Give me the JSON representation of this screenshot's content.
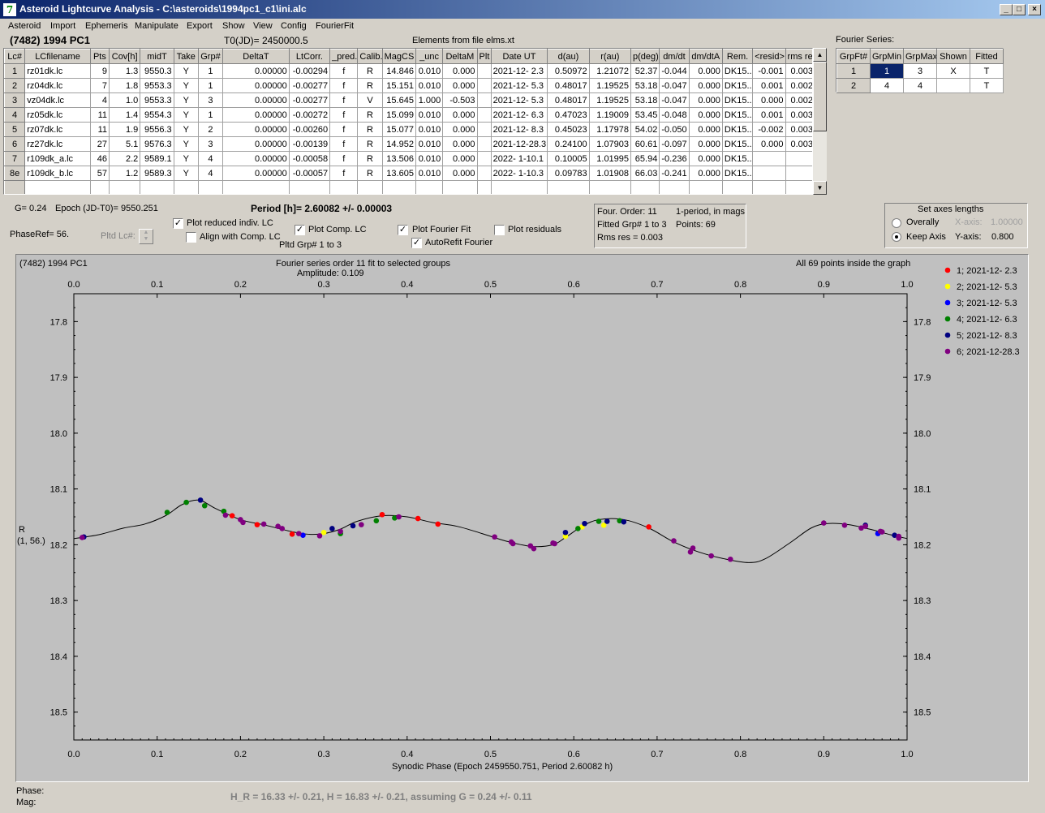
{
  "window": {
    "title": "Asteroid Lightcurve Analysis - C:\\asteroids\\1994pc1_c1\\ini.alc",
    "minimize": "_",
    "maximize": "□",
    "close": "×"
  },
  "menu": [
    "Asteroid",
    "Import",
    "Ephemeris",
    "Manipulate",
    "Export",
    "Show",
    "View",
    "Config",
    "FourierFit"
  ],
  "header": {
    "asteroid": "(7482) 1994 PC1",
    "t0": "T0(JD)= 2450000.5",
    "elements": "Elements from file elms.xt"
  },
  "lc_table": {
    "columns": [
      "Lc#",
      "LCfilename",
      "Pts",
      "Cov[h]",
      "midT",
      "Take",
      "Grp#",
      "DeltaT",
      "LtCorr.",
      "_pred.",
      "Calib.",
      "MagCS",
      "_unc",
      "DeltaM",
      "Plt",
      "Date UT",
      "d(au)",
      "r(au)",
      "p(deg)",
      "dm/dt",
      "dm/dtA",
      "Rem.",
      "<resid>",
      "rms res"
    ],
    "rows": [
      [
        "1",
        "rz01dk.lc",
        "9",
        "1.3",
        "9550.3",
        "Y",
        "1",
        "0.00000",
        "-0.00294",
        "f",
        "R",
        "14.846",
        "0.010",
        "0.000",
        "",
        "2021-12- 2.3",
        "0.50972",
        "1.21072",
        "52.37",
        "-0.044",
        "0.000",
        "DK15..",
        "-0.001",
        "0.003"
      ],
      [
        "2",
        "rz04dk.lc",
        "7",
        "1.8",
        "9553.3",
        "Y",
        "1",
        "0.00000",
        "-0.00277",
        "f",
        "R",
        "15.151",
        "0.010",
        "0.000",
        "",
        "2021-12- 5.3",
        "0.48017",
        "1.19525",
        "53.18",
        "-0.047",
        "0.000",
        "DK15..",
        "0.001",
        "0.002"
      ],
      [
        "3",
        "vz04dk.lc",
        "4",
        "1.0",
        "9553.3",
        "Y",
        "3",
        "0.00000",
        "-0.00277",
        "f",
        "V",
        "15.645",
        "1.000",
        "-0.503",
        "",
        "2021-12- 5.3",
        "0.48017",
        "1.19525",
        "53.18",
        "-0.047",
        "0.000",
        "DK15..",
        "0.000",
        "0.002"
      ],
      [
        "4",
        "rz05dk.lc",
        "11",
        "1.4",
        "9554.3",
        "Y",
        "1",
        "0.00000",
        "-0.00272",
        "f",
        "R",
        "15.099",
        "0.010",
        "0.000",
        "",
        "2021-12- 6.3",
        "0.47023",
        "1.19009",
        "53.45",
        "-0.048",
        "0.000",
        "DK15..",
        "0.001",
        "0.003"
      ],
      [
        "5",
        "rz07dk.lc",
        "11",
        "1.9",
        "9556.3",
        "Y",
        "2",
        "0.00000",
        "-0.00260",
        "f",
        "R",
        "15.077",
        "0.010",
        "0.000",
        "",
        "2021-12- 8.3",
        "0.45023",
        "1.17978",
        "54.02",
        "-0.050",
        "0.000",
        "DK15..",
        "-0.002",
        "0.003"
      ],
      [
        "6",
        "rz27dk.lc",
        "27",
        "5.1",
        "9576.3",
        "Y",
        "3",
        "0.00000",
        "-0.00139",
        "f",
        "R",
        "14.952",
        "0.010",
        "0.000",
        "",
        "2021-12-28.3",
        "0.24100",
        "1.07903",
        "60.61",
        "-0.097",
        "0.000",
        "DK15..",
        "0.000",
        "0.003"
      ],
      [
        "7",
        "r109dk_a.lc",
        "46",
        "2.2",
        "9589.1",
        "Y",
        "4",
        "0.00000",
        "-0.00058",
        "f",
        "R",
        "13.506",
        "0.010",
        "0.000",
        "",
        "2022- 1-10.1",
        "0.10005",
        "1.01995",
        "65.94",
        "-0.236",
        "0.000",
        "DK15..",
        "",
        ""
      ],
      [
        "8e",
        "r109dk_b.lc",
        "57",
        "1.2",
        "9589.3",
        "Y",
        "4",
        "0.00000",
        "-0.00057",
        "f",
        "R",
        "13.605",
        "0.010",
        "0.000",
        "",
        "2022- 1-10.3",
        "0.09783",
        "1.01908",
        "66.03",
        "-0.241",
        "0.000",
        "DK15..",
        "",
        ""
      ]
    ]
  },
  "fourier_series": {
    "label": "Fourier Series:",
    "columns": [
      "GrpFt#",
      "GrpMin",
      "GrpMax",
      "Shown",
      "Fitted"
    ],
    "rows": [
      [
        "1",
        "1",
        "3",
        "X",
        "T"
      ],
      [
        "2",
        "4",
        "4",
        "",
        "T"
      ]
    ]
  },
  "params": {
    "g": "G= 0.24",
    "epoch": "Epoch (JD-T0)= 9550.251",
    "period": "Period [h]= 2.60082 +/- 0.00003",
    "phase_ref": "PhaseRef= 56.",
    "pltd_lc": "Pltd Lc#:",
    "plot_reduced": "Plot reduced indiv. LC",
    "align_comp": "Align with Comp. LC",
    "plot_comp": "Plot Comp. LC",
    "pltd_grp": "Pltd Grp#  1   to   3",
    "plot_fourier": "Plot Fourier Fit",
    "autorefit": "AutoRefit Fourier",
    "plot_residuals": "Plot residuals"
  },
  "fit_info": {
    "order": "Four. Order: 11",
    "mode": "1-period, in mags",
    "fitted": "Fitted Grp# 1 to 3",
    "points": "Points: 69",
    "rms": "Rms res      = 0.003"
  },
  "axes_box": {
    "title": "Set axes lengths",
    "overall": "Overally",
    "keep": "Keep Axis",
    "xlabel": "X-axis:",
    "xval": "1.00000",
    "ylabel": "Y-axis:",
    "yval": "0.800"
  },
  "plot": {
    "obj": "(7482) 1994 PC1",
    "fit_title": "Fourier series order 11 fit to selected groups",
    "amplitude": "Amplitude: 0.109",
    "inside": "All 69 points inside the graph",
    "ylab1": "R",
    "ylab2": "(1, 56.)",
    "xlabel": "Synodic Phase (Epoch 2459550.751, Period 2.60082 h)"
  },
  "footer": {
    "phase": "Phase:",
    "mag": "Mag:",
    "h": "H_R = 16.33 +/- 0.21, H = 16.83 +/- 0.21, assuming G = 0.24 +/- 0.11"
  },
  "chart_data": {
    "type": "scatter",
    "xlim": [
      0,
      1
    ],
    "ylim": [
      17.75,
      18.55
    ],
    "y_inverted": true,
    "xticks": [
      "0.0",
      "0.1",
      "0.2",
      "0.3",
      "0.4",
      "0.5",
      "0.6",
      "0.7",
      "0.8",
      "0.9",
      "1.0"
    ],
    "yticks": [
      "17.8",
      "17.9",
      "18.0",
      "18.1",
      "18.2",
      "18.3",
      "18.4",
      "18.5"
    ],
    "series": [
      {
        "name": "1; 2021-12- 2.3",
        "color": "#ff0000",
        "points": [
          [
            0.19,
            18.148
          ],
          [
            0.22,
            18.164
          ],
          [
            0.262,
            18.181
          ],
          [
            0.37,
            18.146
          ],
          [
            0.413,
            18.153
          ],
          [
            0.437,
            18.163
          ],
          [
            0.69,
            18.168
          ]
        ]
      },
      {
        "name": "2; 2021-12- 5.3",
        "color": "#ffff00",
        "points": [
          [
            0.3,
            18.178
          ],
          [
            0.59,
            18.185
          ],
          [
            0.61,
            18.168
          ],
          [
            0.636,
            18.165
          ]
        ]
      },
      {
        "name": "3; 2021-12- 5.3",
        "color": "#0000ff",
        "points": [
          [
            0.275,
            18.183
          ],
          [
            0.965,
            18.18
          ]
        ]
      },
      {
        "name": "4; 2021-12- 6.3",
        "color": "#008000",
        "points": [
          [
            0.112,
            18.142
          ],
          [
            0.135,
            18.124
          ],
          [
            0.157,
            18.13
          ],
          [
            0.18,
            18.14
          ],
          [
            0.32,
            18.18
          ],
          [
            0.363,
            18.157
          ],
          [
            0.385,
            18.152
          ],
          [
            0.605,
            18.171
          ],
          [
            0.63,
            18.158
          ],
          [
            0.655,
            18.157
          ]
        ]
      },
      {
        "name": "5; 2021-12- 8.3",
        "color": "#000080",
        "points": [
          [
            0.012,
            18.186
          ],
          [
            0.152,
            18.12
          ],
          [
            0.31,
            18.171
          ],
          [
            0.335,
            18.166
          ],
          [
            0.59,
            18.178
          ],
          [
            0.613,
            18.162
          ],
          [
            0.64,
            18.158
          ],
          [
            0.66,
            18.159
          ],
          [
            0.95,
            18.165
          ],
          [
            0.985,
            18.183
          ]
        ]
      },
      {
        "name": "6; 2021-12-28.3",
        "color": "#800080",
        "points": [
          [
            0.01,
            18.187
          ],
          [
            0.182,
            18.147
          ],
          [
            0.2,
            18.155
          ],
          [
            0.203,
            18.16
          ],
          [
            0.228,
            18.163
          ],
          [
            0.245,
            18.167
          ],
          [
            0.25,
            18.171
          ],
          [
            0.27,
            18.18
          ],
          [
            0.295,
            18.184
          ],
          [
            0.32,
            18.176
          ],
          [
            0.345,
            18.164
          ],
          [
            0.39,
            18.15
          ],
          [
            0.505,
            18.186
          ],
          [
            0.525,
            18.195
          ],
          [
            0.527,
            18.198
          ],
          [
            0.548,
            18.202
          ],
          [
            0.552,
            18.207
          ],
          [
            0.575,
            18.197
          ],
          [
            0.577,
            18.198
          ],
          [
            0.72,
            18.193
          ],
          [
            0.74,
            18.213
          ],
          [
            0.743,
            18.206
          ],
          [
            0.765,
            18.22
          ],
          [
            0.788,
            18.226
          ],
          [
            0.9,
            18.161
          ],
          [
            0.925,
            18.165
          ],
          [
            0.945,
            18.17
          ],
          [
            0.95,
            18.167
          ],
          [
            0.968,
            18.176
          ],
          [
            0.97,
            18.177
          ],
          [
            0.99,
            18.188
          ],
          [
            0.99,
            18.185
          ]
        ]
      }
    ],
    "fit_curve": [
      [
        0,
        18.189
      ],
      [
        0.03,
        18.182
      ],
      [
        0.06,
        18.17
      ],
      [
        0.085,
        18.163
      ],
      [
        0.11,
        18.148
      ],
      [
        0.13,
        18.128
      ],
      [
        0.15,
        18.12
      ],
      [
        0.17,
        18.135
      ],
      [
        0.2,
        18.155
      ],
      [
        0.23,
        18.165
      ],
      [
        0.26,
        18.176
      ],
      [
        0.28,
        18.181
      ],
      [
        0.3,
        18.18
      ],
      [
        0.32,
        18.172
      ],
      [
        0.34,
        18.158
      ],
      [
        0.37,
        18.148
      ],
      [
        0.4,
        18.15
      ],
      [
        0.43,
        18.16
      ],
      [
        0.46,
        18.167
      ],
      [
        0.49,
        18.18
      ],
      [
        0.52,
        18.194
      ],
      [
        0.55,
        18.203
      ],
      [
        0.575,
        18.2
      ],
      [
        0.59,
        18.187
      ],
      [
        0.61,
        18.167
      ],
      [
        0.63,
        18.155
      ],
      [
        0.66,
        18.155
      ],
      [
        0.69,
        18.17
      ],
      [
        0.72,
        18.195
      ],
      [
        0.75,
        18.213
      ],
      [
        0.78,
        18.225
      ],
      [
        0.81,
        18.232
      ],
      [
        0.83,
        18.225
      ],
      [
        0.86,
        18.196
      ],
      [
        0.885,
        18.17
      ],
      [
        0.905,
        18.162
      ],
      [
        0.93,
        18.164
      ],
      [
        0.955,
        18.172
      ],
      [
        0.98,
        18.182
      ],
      [
        1.0,
        18.189
      ]
    ]
  }
}
